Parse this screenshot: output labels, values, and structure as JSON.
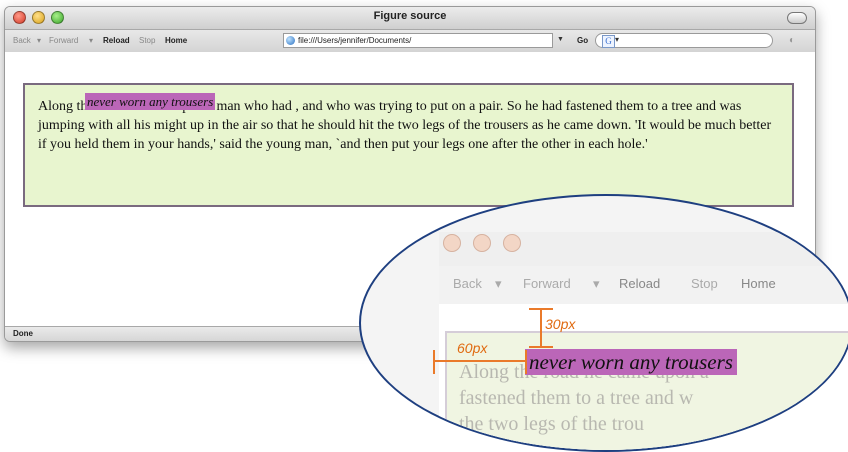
{
  "window": {
    "title": "Figure source",
    "toolbar": {
      "back": "Back",
      "forward": "Forward",
      "reload": "Reload",
      "stop": "Stop",
      "home": "Home",
      "url": "file:///Users/jennifer/Documents/",
      "go": "Go",
      "search_icon_letter": "G"
    },
    "status": "Done"
  },
  "figure": {
    "tag": "never worn any trousers",
    "text": "Along the road he came upon a man who had , and who was trying to put on a pair. So he had fastened them to a tree and was jumping with all his might up in the air so that he should hit the two legs of the trousers as he came down. 'It would be much better if you held them in your hands,' said the young man, `and then put your legs one after the other in each hole.'"
  },
  "zoom": {
    "toolbar": {
      "back": "Back",
      "forward": "Forward",
      "reload": "Reload",
      "stop": "Stop",
      "home": "Home"
    },
    "tag": "never worn any trousers",
    "lines": [
      "Along the road he came upon a",
      "fastened them to a tree and w",
      "the two legs of the trou"
    ],
    "vertical_offset_label": "30px",
    "horizontal_offset_label": "60px"
  },
  "colors": {
    "highlight": "#bb66b8",
    "figure_bg": "#e8f5cf",
    "annotation": "#ea7a2a",
    "lens_border": "#1e3f80"
  }
}
